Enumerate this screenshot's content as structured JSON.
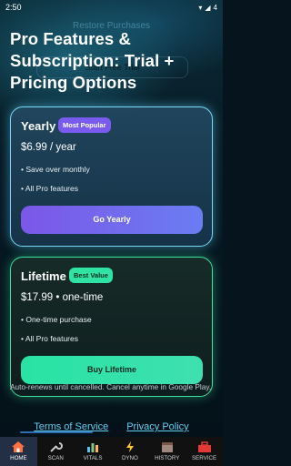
{
  "status": {
    "time": "2:50",
    "battery": "4"
  },
  "ghost": {
    "restore": "Restore Purchases",
    "start": "Start Free Trial"
  },
  "title": "Pro Features & Subscription: Trial + Pricing Options",
  "yearly": {
    "name": "Yearly",
    "badge": "Most Popular",
    "price": "$6.99 / year",
    "features": [
      "• Save over monthly",
      "• All Pro features"
    ],
    "button": "Go Yearly"
  },
  "lifetime": {
    "name": "Lifetime",
    "badge": "Best Value",
    "price": "$17.99 • one-time",
    "features": [
      "• One-time purchase",
      "• All Pro features"
    ],
    "button": "Buy Lifetime"
  },
  "footnote": "Auto-renews until cancelled. Cancel anytime in Google Play.",
  "links": {
    "terms": "Terms of Service",
    "privacy": "Privacy Policy"
  },
  "nav": [
    {
      "label": "HOME",
      "icon": "home-icon"
    },
    {
      "label": "SCAN",
      "icon": "wrench-icon"
    },
    {
      "label": "VITALS",
      "icon": "bars-icon"
    },
    {
      "label": "DYNO",
      "icon": "bolt-icon"
    },
    {
      "label": "HISTORY",
      "icon": "history-icon"
    },
    {
      "label": "SERVICE",
      "icon": "toolbox-icon"
    }
  ],
  "colors": {
    "accent_blue": "#7ad7f5",
    "accent_green": "#3ee0a0",
    "purple": "#7a5bf0"
  }
}
